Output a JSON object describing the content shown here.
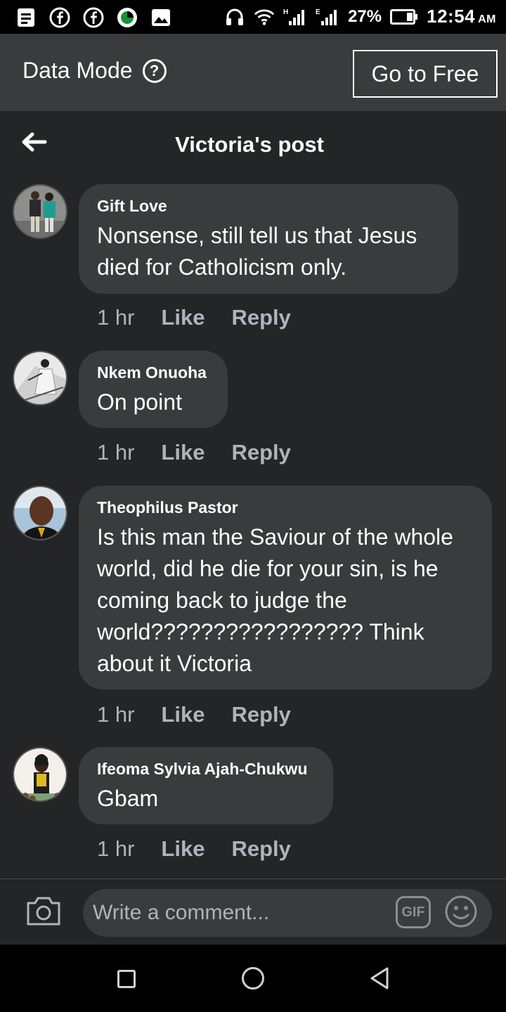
{
  "status_bar": {
    "battery": "27%",
    "time": "12:54",
    "ampm": "AM",
    "signal_label_1": "H",
    "signal_label_2": "E",
    "icons": [
      "notes-icon",
      "facebook-icon",
      "facebook-icon",
      "app-icon",
      "image-icon",
      "headphones-icon",
      "wifi-icon",
      "signal-icon",
      "signal-icon",
      "battery-icon"
    ]
  },
  "data_bar": {
    "label": "Data Mode",
    "help": "?",
    "button": "Go to Free"
  },
  "header": {
    "title": "Victoria's post"
  },
  "comments": [
    {
      "author": "Gift Love",
      "text": "Nonsense, still tell us that Jesus died for Catholicism only.",
      "time": "1 hr",
      "like": "Like",
      "reply": "Reply"
    },
    {
      "author": "Nkem Onuoha",
      "text": "On point",
      "time": "1 hr",
      "like": "Like",
      "reply": "Reply"
    },
    {
      "author": "Theophilus Pastor",
      "text": "Is this man the Saviour of the whole world, did he die for your sin, is he coming back to judge the world????????????????? Think about it Victoria",
      "time": "1 hr",
      "like": "Like",
      "reply": "Reply"
    },
    {
      "author": "Ifeoma Sylvia Ajah-Chukwu",
      "text": "Gbam",
      "time": "1 hr",
      "like": "Like",
      "reply": "Reply"
    }
  ],
  "composer": {
    "placeholder": "Write a comment...",
    "gif": "GIF"
  },
  "colors": {
    "background": "#242527",
    "bubble": "#3a3b3c",
    "meta_text": "#b0b3b8"
  }
}
